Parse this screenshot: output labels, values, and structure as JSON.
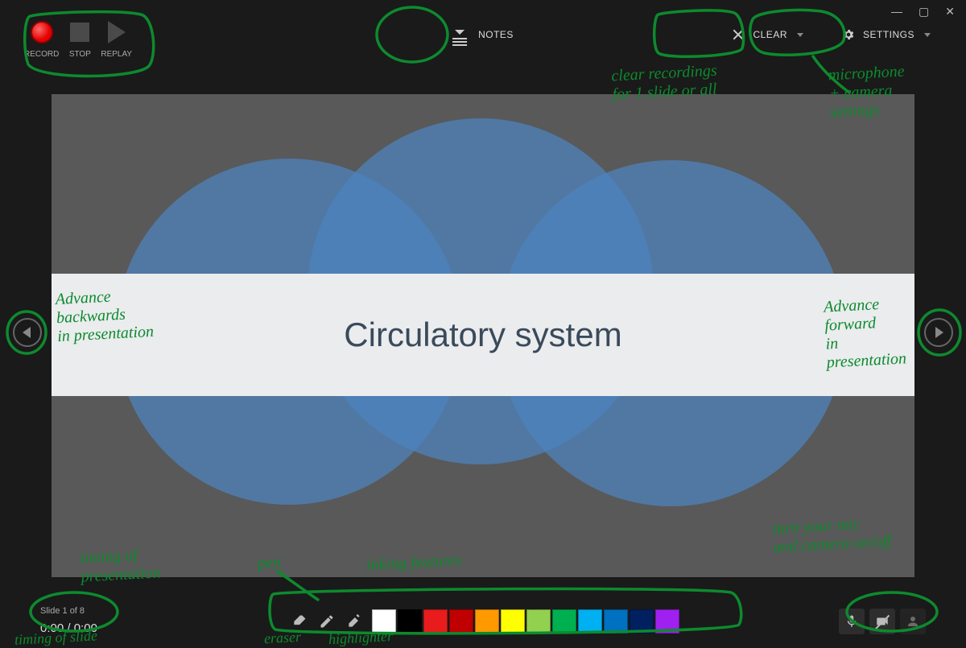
{
  "toolbar": {
    "record": "RECORD",
    "stop": "STOP",
    "replay": "REPLAY",
    "notes": "NOTES",
    "clear": "CLEAR",
    "settings": "SETTINGS"
  },
  "slide": {
    "title": "Circulatory system"
  },
  "status": {
    "slide_label": "Slide 1 of 8",
    "time_current": "0:00",
    "time_separator": " / ",
    "time_total": "0:00"
  },
  "ink_colors": [
    "#ffffff",
    "#000000",
    "#e81c1c",
    "#c00000",
    "#ff9900",
    "#ffff00",
    "#92d050",
    "#00b050",
    "#00b0f0",
    "#0070c0",
    "#002060",
    "#a020f0"
  ],
  "annotations": {
    "clear_note": "clear recordings\nfor 1 slide or all",
    "settings_note": "microphone\n+ camera\nsettings",
    "back_note": "Advance\nbackwards\nin presentation",
    "forward_note": "Advance\nforward\nin\npresentation",
    "timing_pres": "timing of\npresentation",
    "timing_slide": "timing of slide",
    "pen": "pen",
    "ink_feat": "inking features",
    "eraser": "eraser",
    "highlighter": "highlighter",
    "av_note": "turn your mic\nand camera on/off"
  }
}
